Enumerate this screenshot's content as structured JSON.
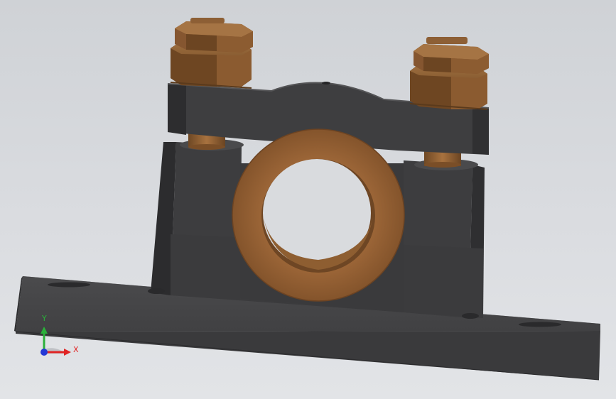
{
  "viewport": {
    "background": "#d8dadd"
  },
  "model": {
    "body_color": "#3b3b3d",
    "bronze_color": "#8a5a2e",
    "nut_color": "#7c5129"
  },
  "triad": {
    "y_label": "Y",
    "x_label": "X",
    "y_color": "#2bb03a",
    "x_color": "#e02424",
    "z_color": "#2438d6"
  }
}
